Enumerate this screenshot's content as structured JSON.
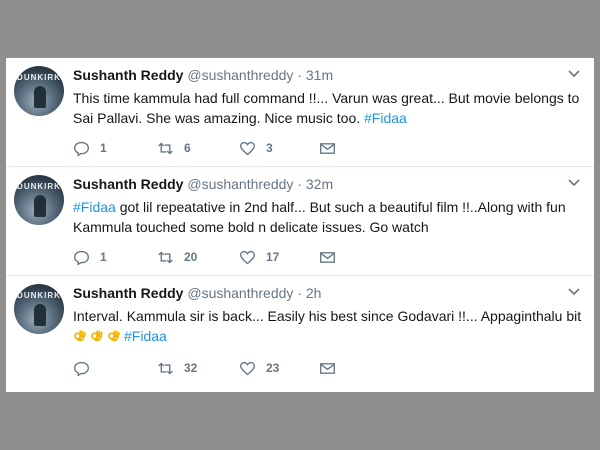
{
  "tweets": [
    {
      "name": "Sushanth Reddy",
      "handle": "@sushanthreddy",
      "separator": "·",
      "time": "31m",
      "avatar_text": "DUNKIRK",
      "text_part1": "This time kammula had full command !!... Varun was great... But movie belongs to Sai Pallavi. She was amazing. Nice music too. ",
      "hashtag": "#Fidaa",
      "replies": "1",
      "retweets": "6",
      "likes": "3"
    },
    {
      "name": "Sushanth Reddy",
      "handle": "@sushanthreddy",
      "separator": "·",
      "time": "32m",
      "avatar_text": "DUNKIRK",
      "hashtag": "#Fidaa",
      "text_part2": " got lil repeatative in 2nd half... But such a beautiful film !!..Along with fun Kammula touched some bold n delicate issues. Go watch",
      "replies": "1",
      "retweets": "20",
      "likes": "17"
    },
    {
      "name": "Sushanth Reddy",
      "handle": "@sushanthreddy",
      "separator": "·",
      "time": "2h",
      "avatar_text": "DUNKIRK",
      "text_part1": "Interval. Kammula sir is back... Easily his best since Godavari !!... Appaginthalu bit ",
      "hashtag": "#Fidaa",
      "emoji_name": "ok-hand-emoji",
      "emoji_count": 3,
      "replies": "",
      "retweets": "32",
      "likes": "23"
    }
  ],
  "colors": {
    "background": "#8f8f8f",
    "card": "#ffffff",
    "hashtag": "#1b95e0",
    "muted": "#657786",
    "text": "#14171a"
  },
  "icons": {
    "reply": "reply-icon",
    "retweet": "retweet-icon",
    "like": "heart-icon",
    "dm": "envelope-icon",
    "menu": "chevron-down-icon"
  }
}
